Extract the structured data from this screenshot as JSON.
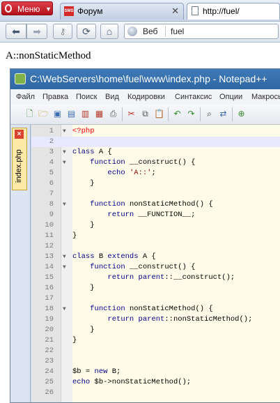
{
  "browser": {
    "menu_label": "Меню",
    "tabs": [
      {
        "title": "Форум",
        "favicon_text": "SMS"
      },
      {
        "title": "http://fuel/"
      }
    ],
    "address_prefix": "Веб",
    "address_value": "fuel"
  },
  "page": {
    "output_text": "A::nonStaticMethod"
  },
  "npp": {
    "window_title": "C:\\WebServers\\home\\fuel\\www\\index.php - Notepad++",
    "menu": [
      "Файл",
      "Правка",
      "Поиск",
      "Вид",
      "Кодировки",
      "Синтаксис",
      "Опции",
      "Макросы"
    ],
    "doc_tab": "index.php",
    "lines": [
      {
        "n": "1",
        "text": "<?php"
      },
      {
        "n": "2",
        "text": ""
      },
      {
        "n": "3",
        "text": "class A {"
      },
      {
        "n": "4",
        "text": "    function __construct() {"
      },
      {
        "n": "5",
        "text": "        echo 'A::';"
      },
      {
        "n": "6",
        "text": "    }"
      },
      {
        "n": "7",
        "text": ""
      },
      {
        "n": "8",
        "text": "    function nonStaticMethod() {"
      },
      {
        "n": "9",
        "text": "        return __FUNCTION__;"
      },
      {
        "n": "10",
        "text": "    }"
      },
      {
        "n": "11",
        "text": "}"
      },
      {
        "n": "12",
        "text": ""
      },
      {
        "n": "13",
        "text": "class B extends A {"
      },
      {
        "n": "14",
        "text": "    function __construct() {"
      },
      {
        "n": "15",
        "text": "        return parent::__construct();"
      },
      {
        "n": "16",
        "text": "    }"
      },
      {
        "n": "17",
        "text": ""
      },
      {
        "n": "18",
        "text": "    function nonStaticMethod() {"
      },
      {
        "n": "19",
        "text": "        return parent::nonStaticMethod();"
      },
      {
        "n": "20",
        "text": "    }"
      },
      {
        "n": "21",
        "text": "}"
      },
      {
        "n": "22",
        "text": ""
      },
      {
        "n": "23",
        "text": ""
      },
      {
        "n": "24",
        "text": "$b = new B;"
      },
      {
        "n": "25",
        "text": "echo $b->nonStaticMethod();"
      },
      {
        "n": "26",
        "text": ""
      }
    ],
    "fold_lines": [
      "1",
      "3",
      "4",
      "8",
      "13",
      "14",
      "18"
    ],
    "current_line": "2"
  }
}
